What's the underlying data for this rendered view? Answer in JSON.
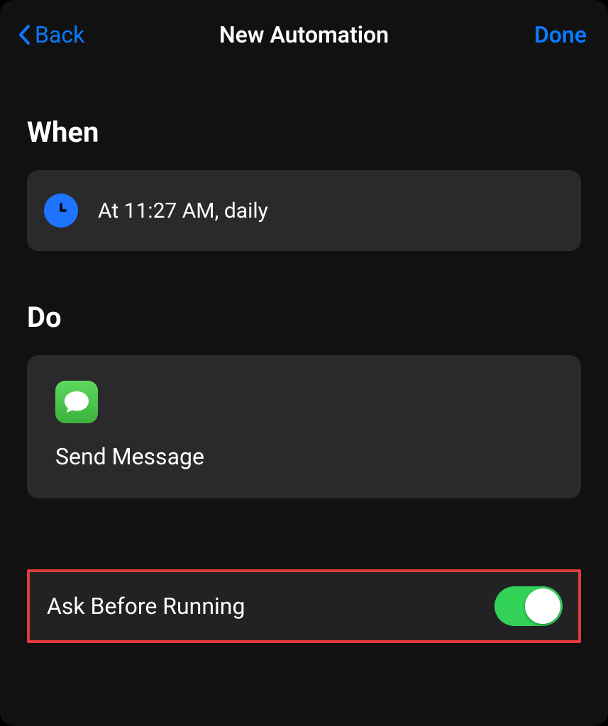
{
  "header": {
    "back_label": "Back",
    "title": "New Automation",
    "done_label": "Done"
  },
  "when": {
    "section_title": "When",
    "condition_text": "At 11:27 AM, daily"
  },
  "do": {
    "section_title": "Do",
    "action_label": "Send Message"
  },
  "settings": {
    "ask_before_running_label": "Ask Before Running",
    "ask_before_running_enabled": true
  }
}
